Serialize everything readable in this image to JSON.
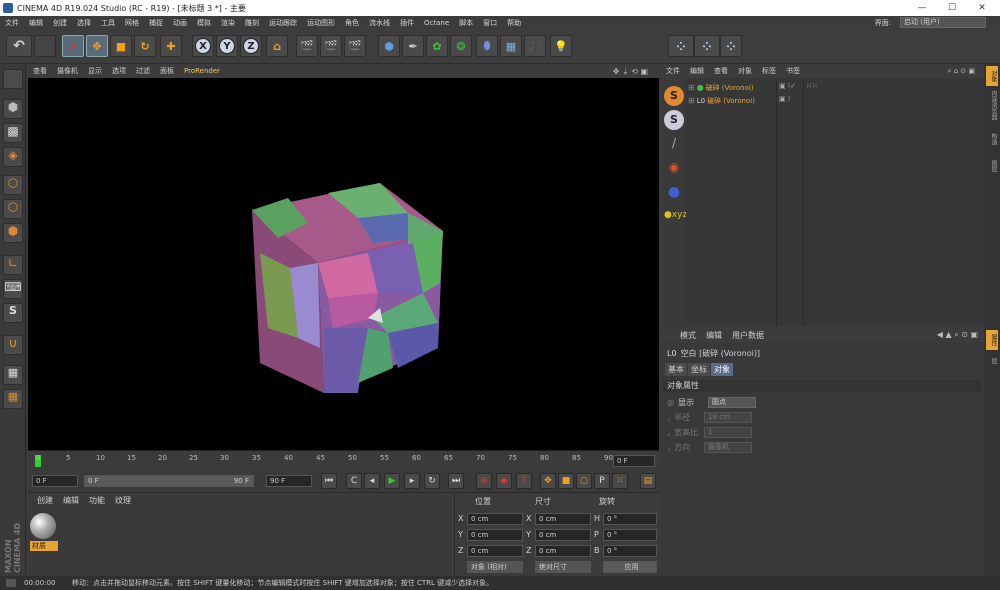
{
  "window": {
    "title": "CINEMA 4D R19.024 Studio (RC - R19) - [未标题 3 *] - 主要",
    "minimize": "—",
    "maximize": "☐",
    "close": "✕"
  },
  "menubar": {
    "items": [
      "文件",
      "编辑",
      "创建",
      "选择",
      "工具",
      "网格",
      "捕捉",
      "动画",
      "模拟",
      "渲染",
      "雕刻",
      "运动跟踪",
      "运动图形",
      "角色",
      "流水线",
      "插件",
      "Octane",
      "脚本",
      "窗口",
      "帮助"
    ],
    "layout_label": "界面:",
    "layout_value": "启动 (用户)"
  },
  "viewport": {
    "menu": [
      "查看",
      "摄像机",
      "显示",
      "选项",
      "过滤",
      "面板",
      "ProRender"
    ]
  },
  "timeline": {
    "ticks": [
      "0",
      "5",
      "10",
      "15",
      "20",
      "25",
      "30",
      "35",
      "40",
      "45",
      "50",
      "55",
      "60",
      "65",
      "70",
      "75",
      "80",
      "85",
      "90"
    ],
    "current_frame": "0 F"
  },
  "transport": {
    "start": "0 F",
    "slider_start": "0 F",
    "slider_end": "90 F",
    "end": "90 F"
  },
  "materials": {
    "menu": [
      "创建",
      "编辑",
      "功能",
      "纹理"
    ],
    "items": [
      {
        "label": "材质"
      }
    ]
  },
  "coords": {
    "headers": [
      "位置",
      "尺寸",
      "旋转"
    ],
    "rows": [
      {
        "axis": "X",
        "pos": "0 cm",
        "size_axis": "X",
        "size": "0 cm",
        "rot_axis": "H",
        "rot": "0 °"
      },
      {
        "axis": "Y",
        "pos": "0 cm",
        "size_axis": "Y",
        "size": "0 cm",
        "rot_axis": "P",
        "rot": "0 °"
      },
      {
        "axis": "Z",
        "pos": "0 cm",
        "size_axis": "Z",
        "size": "0 cm",
        "rot_axis": "B",
        "rot": "0 °"
      }
    ],
    "mode": "对象 (相对)",
    "size_mode": "绝对尺寸",
    "apply": "应用"
  },
  "object_manager": {
    "menu": [
      "文件",
      "编辑",
      "查看",
      "对象",
      "标签",
      "书签"
    ],
    "objects": [
      {
        "name": "破碎 (Voronoi)"
      },
      {
        "name": "破碎 (Voronoi)"
      }
    ]
  },
  "attributes": {
    "menu": [
      "模式",
      "编辑",
      "用户数据"
    ],
    "object_title": "空白 [破碎 (Voronoi)]",
    "tabs": [
      "基本",
      "坐标",
      "对象"
    ],
    "section": "对象属性",
    "fields": [
      {
        "label": "显示",
        "value": "圆点"
      },
      {
        "label": "半径",
        "value": "10 cm"
      },
      {
        "label": "宽高比",
        "value": "1"
      },
      {
        "label": "方向",
        "value": "摄像机"
      }
    ]
  },
  "right_tabs": [
    "对象",
    "内容浏览器",
    "构造",
    "图层",
    "属性",
    "层"
  ],
  "statusbar": {
    "time": "00:00:00",
    "message": "移动：点击并拖动鼠标移动元素。按住 SHIFT 键量化移动；节点编辑模式时按住 SHIFT 键增加选择对象；按住 CTRL 键减少选择对象。"
  },
  "brand": {
    "maxon": "MAXON",
    "product": "CINEMA 4D"
  },
  "colors": {
    "accent": "#e6a437",
    "panel": "#3a3a3a",
    "viewport_bg": "#000000"
  }
}
